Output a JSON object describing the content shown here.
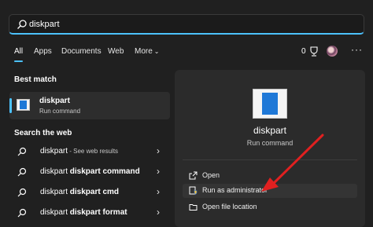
{
  "search": {
    "value": "diskpart"
  },
  "tabs": [
    {
      "label": "All"
    },
    {
      "label": "Apps"
    },
    {
      "label": "Documents"
    },
    {
      "label": "Web"
    },
    {
      "label": "More"
    }
  ],
  "top_right": {
    "points": "0"
  },
  "best_match": {
    "title": "Best match",
    "name": "diskpart",
    "type": "Run command"
  },
  "web": {
    "title": "Search the web",
    "items": [
      {
        "text": "diskpart",
        "sub": " - See web results"
      },
      {
        "text": "diskpart command",
        "sub": ""
      },
      {
        "text": "diskpart cmd",
        "sub": ""
      },
      {
        "text": "diskpart format",
        "sub": ""
      }
    ]
  },
  "preview": {
    "name": "diskpart",
    "type": "Run command",
    "actions": [
      {
        "label": "Open",
        "icon": "open-icon"
      },
      {
        "label": "Run as administrator",
        "icon": "shield-icon"
      },
      {
        "label": "Open file location",
        "icon": "folder-icon"
      }
    ]
  },
  "colors": {
    "accent": "#4cc2ff",
    "background": "#202020",
    "annotation_arrow": "#e02020"
  }
}
